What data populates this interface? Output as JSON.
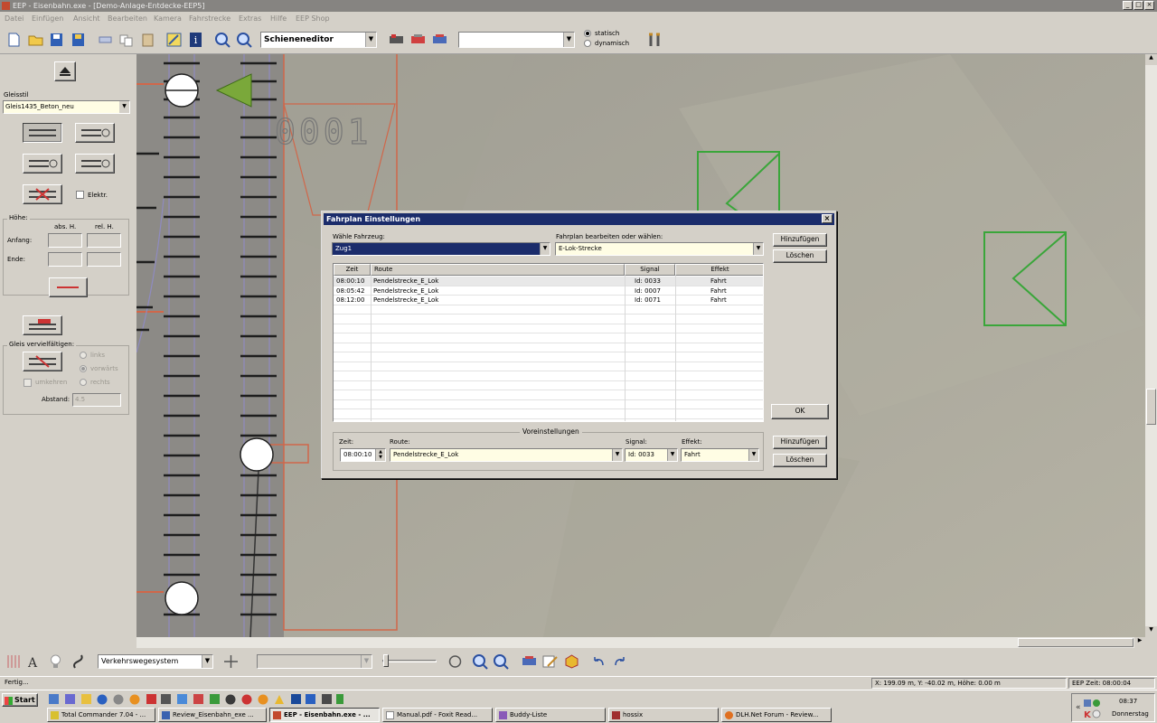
{
  "window": {
    "title": "EEP - Eisenbahn.exe - [Demo-Anlage-Entdecke-EEP5]",
    "minimize_label": "_",
    "maximize_label": "□",
    "close_label": "×"
  },
  "menu": [
    "Datei",
    "Einfügen",
    "Ansicht",
    "Bearbeiten",
    "Kamera",
    "Fahrstrecke",
    "Extras",
    "Hilfe",
    "EEP Shop"
  ],
  "toolbar": {
    "editor_select": "Schieneneditor",
    "second_select": "",
    "mode_options": [
      "statisch",
      "dynamisch"
    ],
    "mode_selected": "statisch"
  },
  "left_panel": {
    "gleisstil_label": "Gleisstil",
    "gleisstil_value": "Gleis1435_Beton_neu",
    "elektr_label": "Elektr.",
    "hoehe_label": "Höhe:",
    "abs_label": "abs. H.",
    "rel_label": "rel. H.",
    "anfang_label": "Anfang:",
    "ende_label": "Ende:",
    "verviel_label": "Gleis vervielfältigen:",
    "links_label": "links",
    "vorwaerts_label": "vorwärts",
    "rechts_label": "rechts",
    "umkehren_label": "umkehren",
    "abstand_label": "Abstand:",
    "abstand_value": "4.5"
  },
  "viewport": {
    "track_number": "0001",
    "colors": {
      "ground": "#a9a79b",
      "tracks": "#8a8680",
      "sleepers": "#222222",
      "red": "#d0674a",
      "green": "#3aa63a"
    }
  },
  "dialog": {
    "title": "Fahrplan Einstellungen",
    "close_label": "×",
    "vehicle_label": "Wähle Fahrzeug:",
    "vehicle_value": "Zug1",
    "schedule_label": "Fahrplan bearbeiten oder wählen:",
    "schedule_value": "E-Lok-Strecke",
    "add_label": "Hinzufügen",
    "delete_label": "Löschen",
    "ok_label": "OK",
    "columns": [
      "Zeit",
      "Route",
      "Signal",
      "Effekt"
    ],
    "rows": [
      [
        "08:00:10",
        "Pendelstrecke_E_Lok",
        "Id: 0033",
        "Fahrt"
      ],
      [
        "08:05:42",
        "Pendelstrecke_E_Lok",
        "Id: 0007",
        "Fahrt"
      ],
      [
        "08:12:00",
        "Pendelstrecke_E_Lok",
        "Id: 0071",
        "Fahrt"
      ]
    ],
    "presets": {
      "legend": "Voreinstellungen",
      "zeit_label": "Zeit:",
      "zeit_value": "08:00:10",
      "route_label": "Route:",
      "route_value": "Pendelstrecke_E_Lok",
      "signal_label": "Signal:",
      "signal_value": "Id: 0033",
      "effekt_label": "Effekt:",
      "effekt_value": "Fahrt"
    }
  },
  "bottom_toolbar": {
    "system_select": "Verkehrswegesystem",
    "second_select": ""
  },
  "status": {
    "left": "Fertig...",
    "coords": "X: 199.09 m,  Y: -40.02 m,  Höhe: 0.00 m",
    "eep_time": "EEP Zeit: 08:00:04"
  },
  "taskbar": {
    "start_label": "Start",
    "tasks": [
      "Total Commander 7.04 - ...",
      "Review_Eisenbahn_exe ...",
      "EEP - Eisenbahn.exe - ...",
      "Manual.pdf - Foxit Read...",
      "Buddy-Liste",
      "hossix",
      "DLH.Net Forum - Review..."
    ],
    "active_task": 2,
    "clock": "08:37",
    "day": "Donnerstag"
  }
}
